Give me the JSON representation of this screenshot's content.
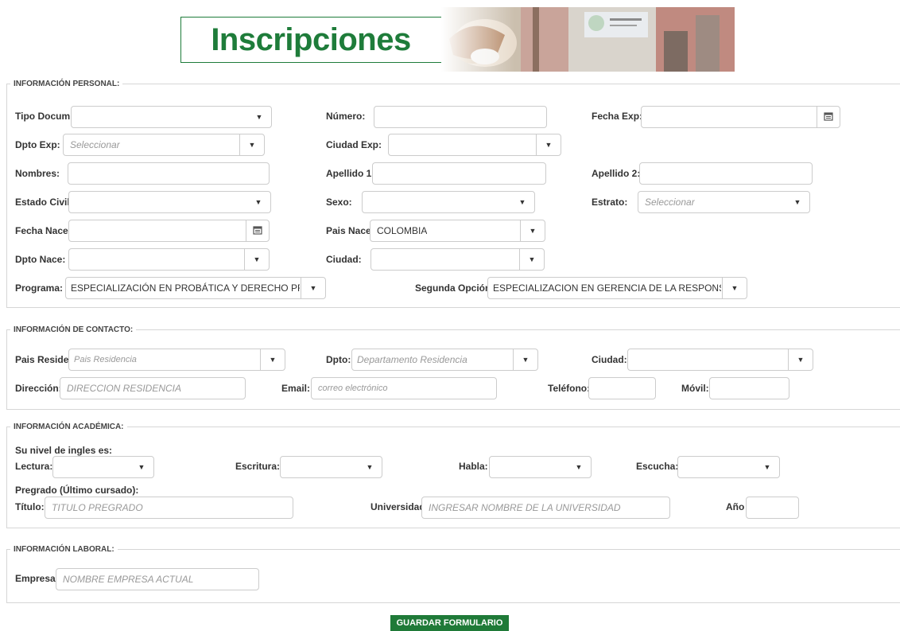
{
  "banner": {
    "title": "Inscripciones"
  },
  "personal": {
    "legend": "INFORMACIÓN PERSONAL:",
    "tipo_docum": {
      "label": "Tipo Docum:",
      "value": ""
    },
    "numero": {
      "label": "Número:",
      "value": ""
    },
    "fecha_exp": {
      "label": "Fecha Exp:",
      "value": ""
    },
    "dpto_exp": {
      "label": "Dpto Exp:",
      "placeholder": "Seleccionar"
    },
    "ciudad_exp": {
      "label": "Ciudad Exp:",
      "value": ""
    },
    "nombres": {
      "label": "Nombres:",
      "value": ""
    },
    "apellido1": {
      "label": "Apellido 1:",
      "value": ""
    },
    "apellido2": {
      "label": "Apellido 2:",
      "value": ""
    },
    "estado_civil": {
      "label": "Estado Civil:",
      "value": ""
    },
    "sexo": {
      "label": "Sexo:",
      "value": ""
    },
    "estrato": {
      "label": "Estrato:",
      "placeholder": "Seleccionar"
    },
    "fecha_nace": {
      "label": "Fecha Nace:",
      "value": ""
    },
    "pais_nace": {
      "label": "Pais Nace:",
      "value": "COLOMBIA"
    },
    "dpto_nace": {
      "label": "Dpto Nace:",
      "value": ""
    },
    "ciudad": {
      "label": "Ciudad:",
      "value": ""
    },
    "programa": {
      "label": "Programa:",
      "value": "ESPECIALIZACIÓN EN PROBÁTICA Y DERECHO PROE"
    },
    "segunda": {
      "label": "Segunda Opción:",
      "value": "ESPECIALIZACION EN GERENCIA DE LA RESPONSAB"
    }
  },
  "contacto": {
    "legend": "INFORMACIÓN DE CONTACTO:",
    "pais_reside": {
      "label": "Pais Reside:",
      "placeholder": "Pais Residencia"
    },
    "dpto": {
      "label": "Dpto:",
      "placeholder": "Departamento Residencia"
    },
    "ciudad": {
      "label": "Ciudad:",
      "value": ""
    },
    "direccion": {
      "label": "Dirección:",
      "placeholder": "DIRECCION RESIDENCIA"
    },
    "email": {
      "label": "Email:",
      "placeholder": "correo electrónico"
    },
    "telefono": {
      "label": "Teléfono:",
      "value": ""
    },
    "movil": {
      "label": "Móvil:",
      "value": ""
    }
  },
  "academica": {
    "legend": "INFORMACIÓN ACADÉMICA:",
    "nivel_ingles": "Su nivel de ingles es:",
    "lectura": {
      "label": "Lectura:",
      "value": ""
    },
    "escritura": {
      "label": "Escritura:",
      "value": ""
    },
    "habla": {
      "label": "Habla:",
      "value": ""
    },
    "escucha": {
      "label": "Escucha:",
      "value": ""
    },
    "pregrado": "Pregrado (Último cursado):",
    "titulo": {
      "label": "Título:",
      "placeholder": "TITULO PREGRADO"
    },
    "universidad": {
      "label": "Universidad",
      "placeholder": "INGRESAR NOMBRE DE LA UNIVERSIDAD"
    },
    "anio": {
      "label": "Año",
      "value": ""
    }
  },
  "laboral": {
    "legend": "INFORMACIÓN LABORAL:",
    "empresa": {
      "label": "Empresa:",
      "placeholder": "NOMBRE EMPRESA ACTUAL"
    }
  },
  "submit_label": "GUARDAR FORMULARIO",
  "colors": {
    "brand_green": "#1f7a38",
    "banner_text": "#1e7c3a"
  },
  "icons": {
    "select_arrow": "triangle-down",
    "date_picker": "calendar-icon"
  }
}
